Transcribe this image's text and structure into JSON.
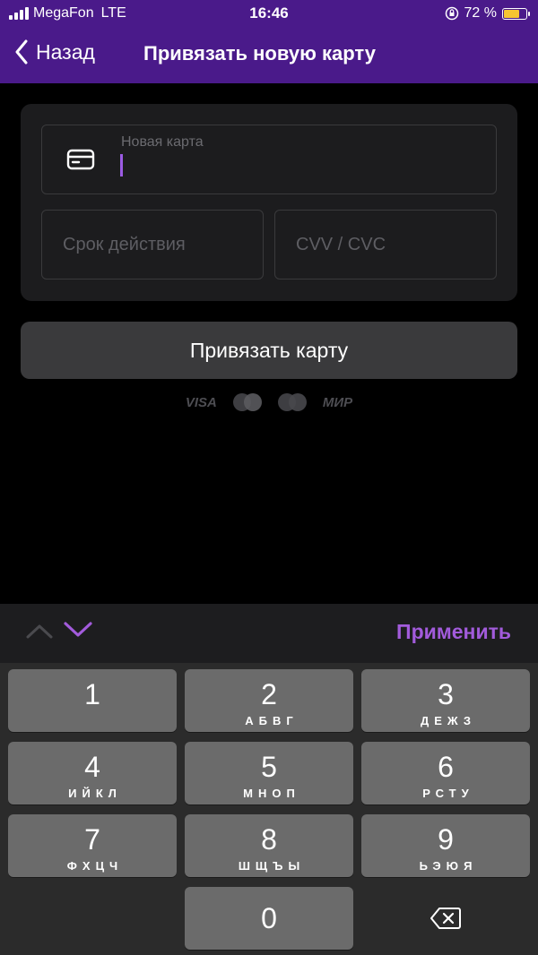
{
  "status_bar": {
    "carrier": "MegaFon",
    "network": "LTE",
    "time": "16:46",
    "battery_percent": "72 %",
    "battery_level": 0.72
  },
  "nav": {
    "back_label": "Назад",
    "title": "Привязать новую карту"
  },
  "form": {
    "card_number_label": "Новая карта",
    "card_number_value": "",
    "expiry_placeholder": "Срок действия",
    "cvv_placeholder": "CVV / CVC"
  },
  "bind_button_label": "Привязать карту",
  "payment_logos": {
    "visa": "VISA",
    "mir": "МИР"
  },
  "keyboard": {
    "apply_label": "Применить",
    "keys": [
      {
        "num": "1",
        "letters": ""
      },
      {
        "num": "2",
        "letters": "АБВГ"
      },
      {
        "num": "3",
        "letters": "ДЕЖЗ"
      },
      {
        "num": "4",
        "letters": "ИЙКЛ"
      },
      {
        "num": "5",
        "letters": "МНОП"
      },
      {
        "num": "6",
        "letters": "РСТУ"
      },
      {
        "num": "7",
        "letters": "ФХЦЧ"
      },
      {
        "num": "8",
        "letters": "ШЩЪЫ"
      },
      {
        "num": "9",
        "letters": "ЬЭЮЯ"
      },
      {
        "num": "0",
        "letters": ""
      }
    ]
  },
  "colors": {
    "header": "#4a1a8a",
    "accent": "#a25bdb",
    "background": "#000000"
  }
}
